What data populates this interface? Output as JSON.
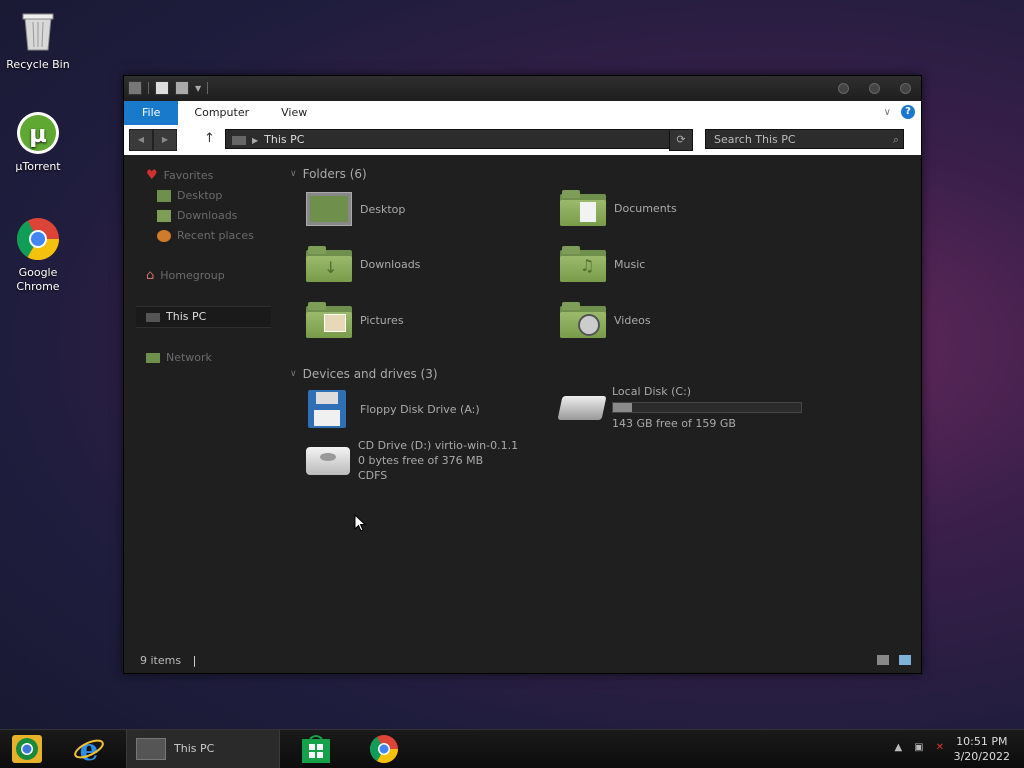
{
  "desktop": {
    "icons": [
      {
        "label": "Recycle Bin",
        "icon": "recycle-bin-icon"
      },
      {
        "label": "µTorrent",
        "icon": "utorrent-icon"
      },
      {
        "label": "Google Chrome",
        "icon": "chrome-icon"
      }
    ]
  },
  "window": {
    "ribbon": {
      "file": "File",
      "computer": "Computer",
      "view": "View",
      "help": "?"
    },
    "address": {
      "path": "This PC"
    },
    "search": {
      "placeholder": "Search This PC"
    },
    "nav": {
      "favorites": "Favorites",
      "desktop": "Desktop",
      "downloads": "Downloads",
      "recent": "Recent places",
      "homegroup": "Homegroup",
      "this_pc": "This PC",
      "network": "Network"
    },
    "folders_header": "Folders (6)",
    "folders": [
      {
        "label": "Desktop"
      },
      {
        "label": "Documents"
      },
      {
        "label": "Downloads"
      },
      {
        "label": "Music"
      },
      {
        "label": "Pictures"
      },
      {
        "label": "Videos"
      }
    ],
    "devices_header": "Devices and drives (3)",
    "floppy": {
      "label": "Floppy Disk Drive (A:)"
    },
    "local_disk": {
      "label": "Local Disk (C:)",
      "free": "143 GB free of 159 GB",
      "used_fraction": 0.1
    },
    "cd": {
      "label": "CD Drive (D:) virtio-win-0.1.1",
      "free": "0 bytes free of 376 MB",
      "fs": "CDFS"
    },
    "status": "9 items"
  },
  "taskbar": {
    "active_window": "This PC",
    "time": "10:51 PM",
    "date": "3/20/2022"
  }
}
